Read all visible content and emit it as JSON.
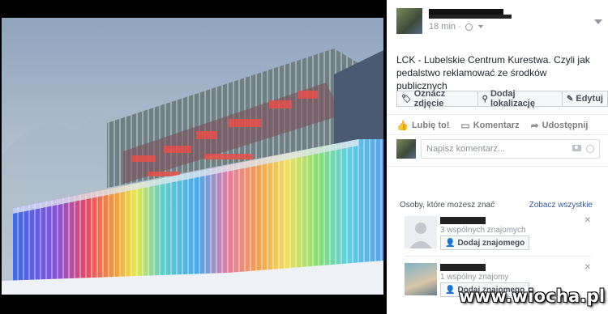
{
  "post": {
    "timestamp": "18 min",
    "privacy_icon": "globe-icon",
    "text": "LCK - Lubelskie Centrum Kurestwa. Czyli jak pedalstwo reklamować ze środków publicznych",
    "tag_buttons": [
      {
        "label": "Oznacz zdjęcie",
        "icon": "tag-icon"
      },
      {
        "label": "Dodaj lokalizację",
        "icon": "location-pin-icon"
      },
      {
        "label": "Edytuj",
        "icon": "pencil-icon"
      }
    ],
    "actions": [
      {
        "label": "Lubię to!",
        "icon": "thumbs-up-icon"
      },
      {
        "label": "Komentarz",
        "icon": "comment-icon"
      },
      {
        "label": "Udostępnij",
        "icon": "share-icon"
      }
    ],
    "comment_placeholder": "Napisz komentarz..."
  },
  "suggestions": {
    "title": "Osoby, które możesz znać",
    "see_all": "Zobacz wszystkie",
    "people": [
      {
        "mutual": "3 wspólnych znajomych",
        "button": "Dodaj znajomego"
      },
      {
        "mutual": "1 wspólny znajomy",
        "button": "Dodaj znajomego"
      }
    ]
  },
  "watermark": "www.wiocha.pl"
}
